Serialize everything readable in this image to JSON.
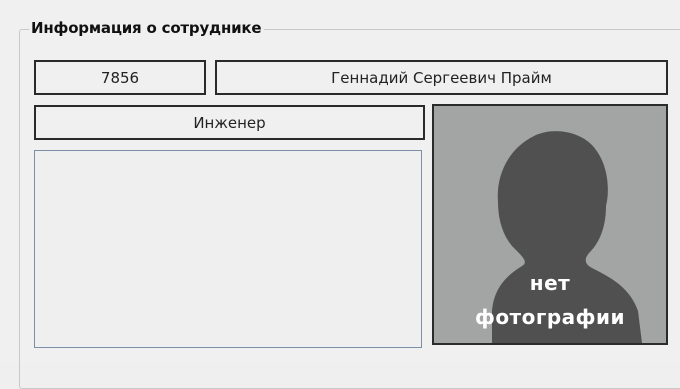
{
  "group": {
    "title": "Информация о сотруднике"
  },
  "employee": {
    "id": "7856",
    "full_name": "Геннадий Сергеевич Прайм",
    "position": "Инженер",
    "notes": ""
  },
  "photo": {
    "caption_line1": "нет",
    "caption_line2": "фотографии",
    "icon": "person-silhouette-icon"
  }
}
